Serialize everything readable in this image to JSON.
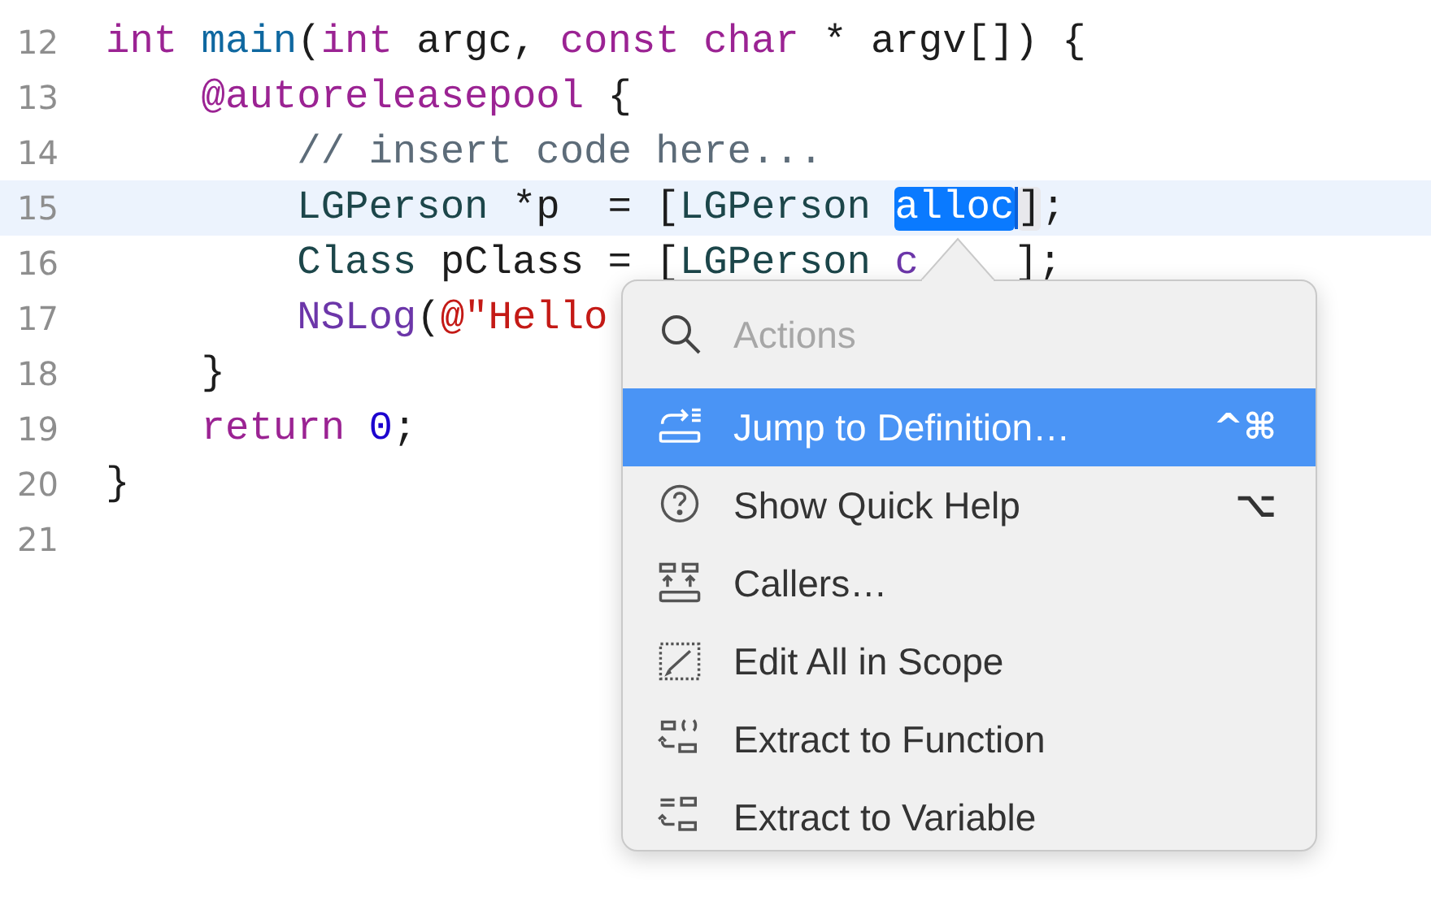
{
  "editor": {
    "lines": [
      {
        "number": "12",
        "current": false,
        "tokens": [
          {
            "kind": "keyword",
            "text": "int"
          },
          {
            "kind": "function",
            "text": " main"
          },
          {
            "kind": "plain",
            "text": "("
          },
          {
            "kind": "keyword",
            "text": "int"
          },
          {
            "kind": "plain",
            "text": " argc, "
          },
          {
            "kind": "keyword",
            "text": "const char"
          },
          {
            "kind": "plain",
            "text": " * argv[]) {"
          }
        ]
      },
      {
        "number": "13",
        "current": false,
        "tokens": [
          {
            "kind": "keyword",
            "text": "    @autoreleasepool"
          },
          {
            "kind": "plain",
            "text": " {"
          }
        ]
      },
      {
        "number": "14",
        "current": false,
        "tokens": [
          {
            "kind": "comment",
            "text": "        // insert code here..."
          }
        ]
      },
      {
        "number": "15",
        "current": true,
        "tokens": [
          {
            "kind": "type",
            "text": "        LGPerson"
          },
          {
            "kind": "plain",
            "text": " *p  = ["
          },
          {
            "kind": "type",
            "text": "LGPerson "
          },
          {
            "kind": "selection",
            "text": "alloc"
          },
          {
            "kind": "match",
            "text": "]"
          },
          {
            "kind": "plain",
            "text": ";"
          }
        ]
      },
      {
        "number": "16",
        "current": false,
        "tokens": [
          {
            "kind": "type",
            "text": "        Class"
          },
          {
            "kind": "plain",
            "text": " pClass = ["
          },
          {
            "kind": "type",
            "text": "LGPerson "
          },
          {
            "kind": "method",
            "text": "c"
          },
          {
            "kind": "plain",
            "text": "];",
            "after_gap": true
          }
        ]
      },
      {
        "number": "17",
        "current": false,
        "tokens": [
          {
            "kind": "method",
            "text": "        NSLog"
          },
          {
            "kind": "plain",
            "text": "("
          },
          {
            "kind": "string",
            "text": "@\"Hello"
          }
        ]
      },
      {
        "number": "18",
        "current": false,
        "tokens": [
          {
            "kind": "plain",
            "text": "    }"
          }
        ]
      },
      {
        "number": "19",
        "current": false,
        "tokens": [
          {
            "kind": "keyword",
            "text": "    return "
          },
          {
            "kind": "number",
            "text": "0"
          },
          {
            "kind": "plain",
            "text": ";"
          }
        ]
      },
      {
        "number": "20",
        "current": false,
        "tokens": [
          {
            "kind": "plain",
            "text": "}"
          }
        ]
      },
      {
        "number": "21",
        "current": false
      }
    ]
  },
  "actions_menu": {
    "search": {
      "placeholder": "Actions"
    },
    "items": [
      {
        "kind": "jump",
        "label": "Jump to Definition…",
        "shortcut": "^⌘",
        "selected": true
      },
      {
        "kind": "help",
        "label": "Show Quick Help",
        "shortcut": "⌥",
        "selected": false
      },
      {
        "kind": "callers",
        "label": "Callers…",
        "selected": false
      },
      {
        "kind": "edit",
        "label": "Edit All in Scope",
        "selected": false
      },
      {
        "kind": "function",
        "label": "Extract to Function",
        "selected": false
      },
      {
        "kind": "variable",
        "label": "Extract to Variable",
        "selected": false
      }
    ]
  }
}
